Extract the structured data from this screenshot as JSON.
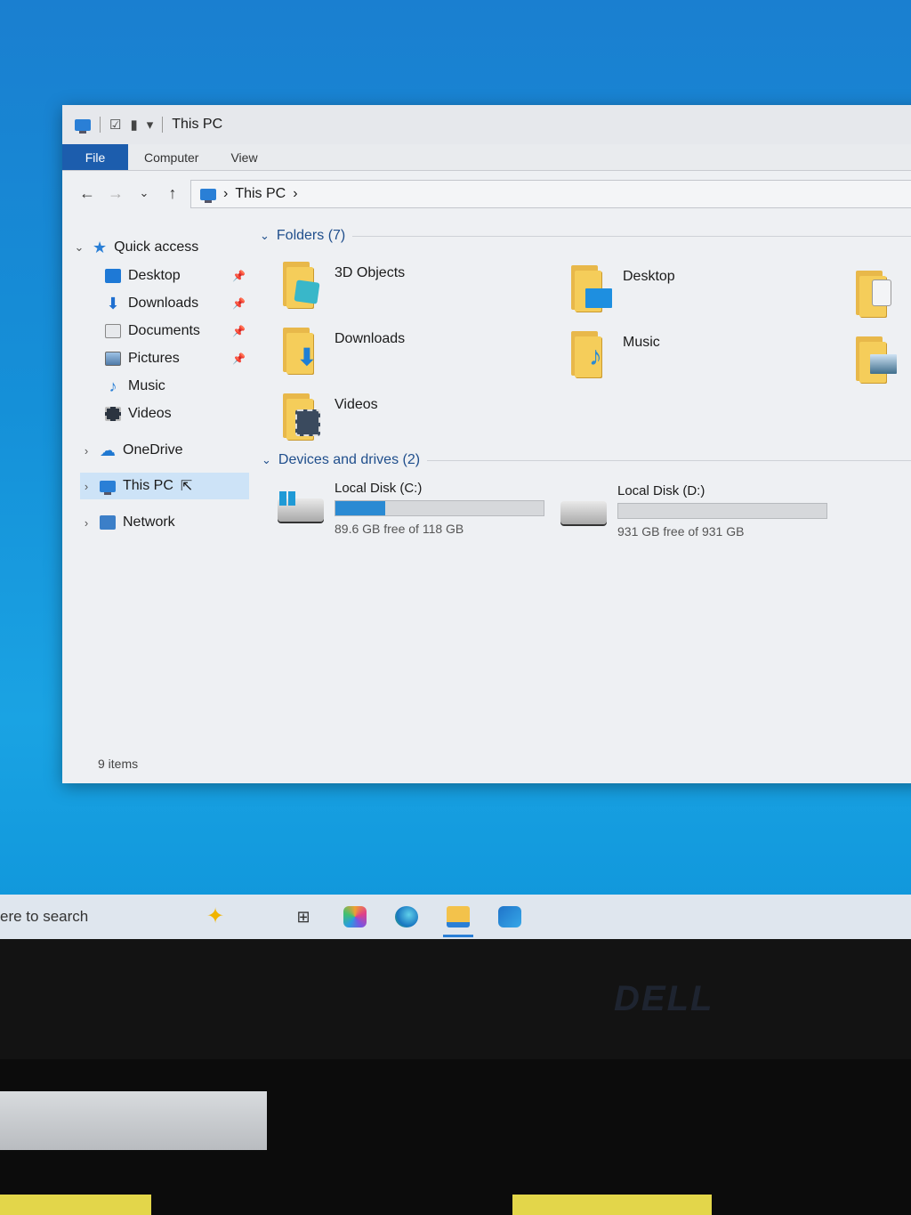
{
  "window": {
    "title": "This PC",
    "ribbon_tabs": [
      "File",
      "Computer",
      "View"
    ],
    "address": "This PC"
  },
  "sidebar": {
    "quick_access": "Quick access",
    "items": [
      {
        "label": "Desktop",
        "icon": "desktop-folder-icon",
        "pinned": true
      },
      {
        "label": "Downloads",
        "icon": "downloads-icon",
        "pinned": true
      },
      {
        "label": "Documents",
        "icon": "documents-icon",
        "pinned": true
      },
      {
        "label": "Pictures",
        "icon": "pictures-icon",
        "pinned": true
      },
      {
        "label": "Music",
        "icon": "music-icon",
        "pinned": false
      },
      {
        "label": "Videos",
        "icon": "videos-icon",
        "pinned": false
      }
    ],
    "onedrive": "OneDrive",
    "this_pc": "This PC",
    "network": "Network"
  },
  "content": {
    "folders_header": "Folders (7)",
    "folders": [
      {
        "label": "3D Objects",
        "icon": "3d-objects-icon",
        "badge_color": "#39b7c9"
      },
      {
        "label": "Desktop",
        "icon": "desktop-folder-icon",
        "badge_color": "#1e8fe0"
      },
      {
        "label": "Downloads",
        "icon": "downloads-folder-icon",
        "badge_color": "#1f7fd4"
      },
      {
        "label": "Music",
        "icon": "music-folder-icon",
        "badge_color": "#2a8ad3"
      },
      {
        "label": "Videos",
        "icon": "videos-folder-icon",
        "badge_color": "#3a4a5e"
      }
    ],
    "drives_header": "Devices and drives (2)",
    "drives": [
      {
        "label": "Local Disk (C:)",
        "free_text": "89.6 GB free of 118 GB",
        "used_fraction": 0.24,
        "system": true
      },
      {
        "label": "Local Disk (D:)",
        "free_text": "931 GB free of 931 GB",
        "used_fraction": 0.0,
        "system": false
      }
    ]
  },
  "status": {
    "items": "9 items"
  },
  "taskbar": {
    "search_text": "ere to search",
    "apps": [
      "task-view-icon",
      "copilot-icon",
      "edge-icon",
      "file-explorer-icon",
      "outlook-icon"
    ]
  },
  "brand": "DELL",
  "colors": {
    "accent": "#1c5dad",
    "selection": "#cde3f7",
    "drive_fill": "#2a8ad3"
  }
}
